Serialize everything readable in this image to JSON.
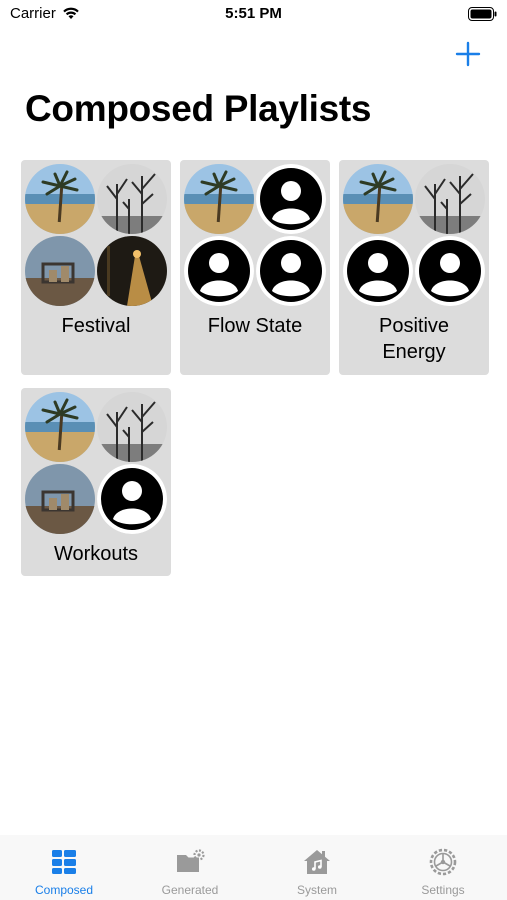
{
  "status_bar": {
    "carrier": "Carrier",
    "time": "5:51 PM"
  },
  "header": {
    "title": "Composed Playlists",
    "add_icon": "plus-icon"
  },
  "playlists": [
    {
      "name": "Festival",
      "thumbs": [
        "beach-palm",
        "bare-trees",
        "playground",
        "night-path"
      ]
    },
    {
      "name": "Flow State",
      "thumbs": [
        "beach-palm",
        "person",
        "person",
        "person"
      ]
    },
    {
      "name": "Positive\nEnergy",
      "thumbs": [
        "beach-palm",
        "bare-trees",
        "person",
        "person"
      ]
    },
    {
      "name": "Workouts",
      "thumbs": [
        "beach-palm",
        "bare-trees",
        "playground",
        "person"
      ]
    }
  ],
  "tabs": [
    {
      "label": "Composed",
      "icon": "grid-icon",
      "active": true
    },
    {
      "label": "Generated",
      "icon": "folder-gear-icon",
      "active": false
    },
    {
      "label": "System",
      "icon": "house-music-icon",
      "active": false
    },
    {
      "label": "Settings",
      "icon": "gear-icon",
      "active": false
    }
  ],
  "colors": {
    "accent": "#1a7fe8",
    "card_bg": "#dcdcdc",
    "inactive_tab": "#9a9a9a"
  }
}
